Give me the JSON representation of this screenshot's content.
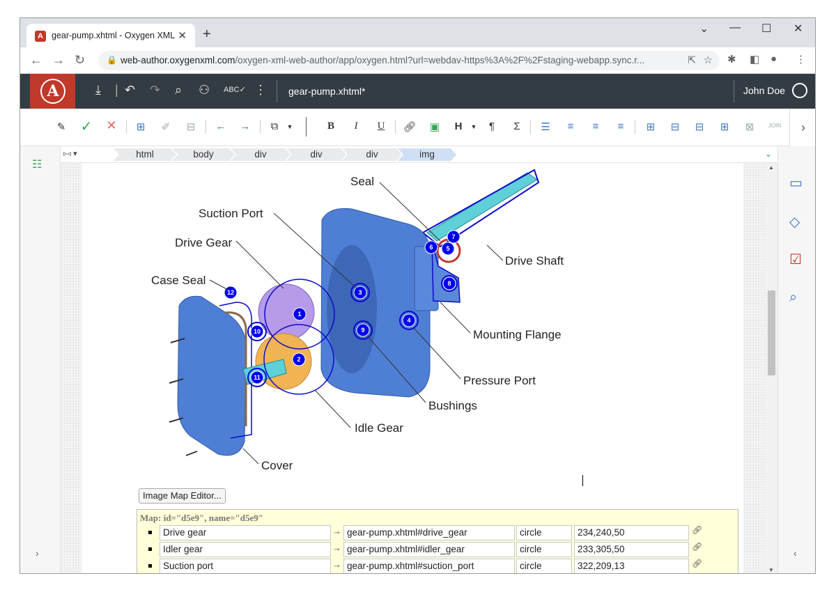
{
  "browser": {
    "tab_title": "gear-pump.xhtml - Oxygen XML",
    "tab_favicon": "oxygen-logo",
    "new_tab_label": "+",
    "url_host": "web-author.oxygenxml.com",
    "url_path": "/oxygen-xml-web-author/app/oxygen.html?url=webdav-https%3A%2F%2Fstaging-webapp.sync.r...",
    "window_controls": [
      "⌄",
      "—",
      "☐",
      "✕"
    ]
  },
  "app": {
    "doc_title": "gear-pump.xhtml*",
    "user_name": "John Doe",
    "accent": "#c0392b",
    "header_bg": "#333c43"
  },
  "breadcrumb": [
    "html",
    "body",
    "div",
    "div",
    "div",
    "img"
  ],
  "diagram": {
    "labels": {
      "seal": "Seal",
      "suction_port": "Suction Port",
      "drive_gear": "Drive Gear",
      "case_seal": "Case Seal",
      "drive_shaft": "Drive Shaft",
      "mounting_flange": "Mounting Flange",
      "pressure_port": "Pressure Port",
      "bushings": "Bushings",
      "idle_gear": "Idle Gear",
      "cover": "Cover"
    },
    "hotspots": [
      "1",
      "2",
      "3",
      "4",
      "5",
      "6",
      "7",
      "8",
      "9",
      "10",
      "11",
      "12"
    ]
  },
  "image_map": {
    "button_label": "Image Map Editor...",
    "title": "Map: id=\"d5e9\", name=\"d5e9\"",
    "rows": [
      {
        "label": "Drive gear",
        "href": "gear-pump.xhtml#drive_gear",
        "shape": "circle",
        "coords": "234,240,50"
      },
      {
        "label": "Idler gear",
        "href": "gear-pump.xhtml#idler_gear",
        "shape": "circle",
        "coords": "233,305,50"
      },
      {
        "label": "Suction port",
        "href": "gear-pump.xhtml#suction_port",
        "shape": "circle",
        "coords": "322,209,13"
      }
    ]
  }
}
